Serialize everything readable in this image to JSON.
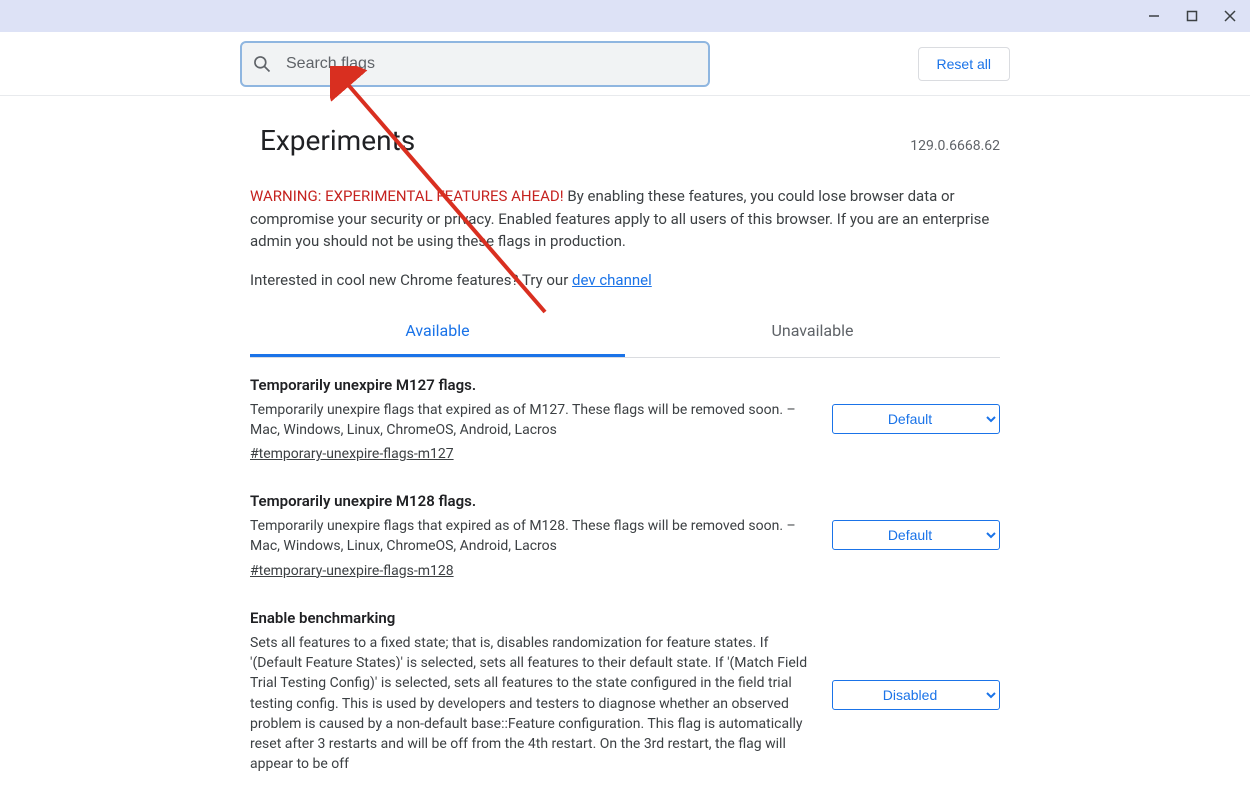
{
  "search": {
    "placeholder": "Search flags"
  },
  "reset_label": "Reset all",
  "page_title": "Experiments",
  "version": "129.0.6668.62",
  "warning_prefix": "WARNING: EXPERIMENTAL FEATURES AHEAD!",
  "warning_body": " By enabling these features, you could lose browser data or compromise your security or privacy. Enabled features apply to all users of this browser. If you are an enterprise admin you should not be using these flags in production.",
  "interest_prefix": "Interested in cool new Chrome features? Try our ",
  "dev_channel_label": "dev channel",
  "tabs": {
    "available": "Available",
    "unavailable": "Unavailable"
  },
  "flags": [
    {
      "title": "Temporarily unexpire M127 flags.",
      "desc": "Temporarily unexpire flags that expired as of M127. These flags will be removed soon. – Mac, Windows, Linux, ChromeOS, Android, Lacros",
      "anchor": "#temporary-unexpire-flags-m127",
      "value": "Default"
    },
    {
      "title": "Temporarily unexpire M128 flags.",
      "desc": "Temporarily unexpire flags that expired as of M128. These flags will be removed soon. – Mac, Windows, Linux, ChromeOS, Android, Lacros",
      "anchor": "#temporary-unexpire-flags-m128",
      "value": "Default"
    },
    {
      "title": "Enable benchmarking",
      "desc": "Sets all features to a fixed state; that is, disables randomization for feature states. If '(Default Feature States)' is selected, sets all features to their default state. If '(Match Field Trial Testing Config)' is selected, sets all features to the state configured in the field trial testing config. This is used by developers and testers to diagnose whether an observed problem is caused by a non-default base::Feature configuration. This flag is automatically reset after 3 restarts and will be off from the 4th restart. On the 3rd restart, the flag will appear to be off",
      "anchor": "",
      "value": "Disabled"
    }
  ]
}
